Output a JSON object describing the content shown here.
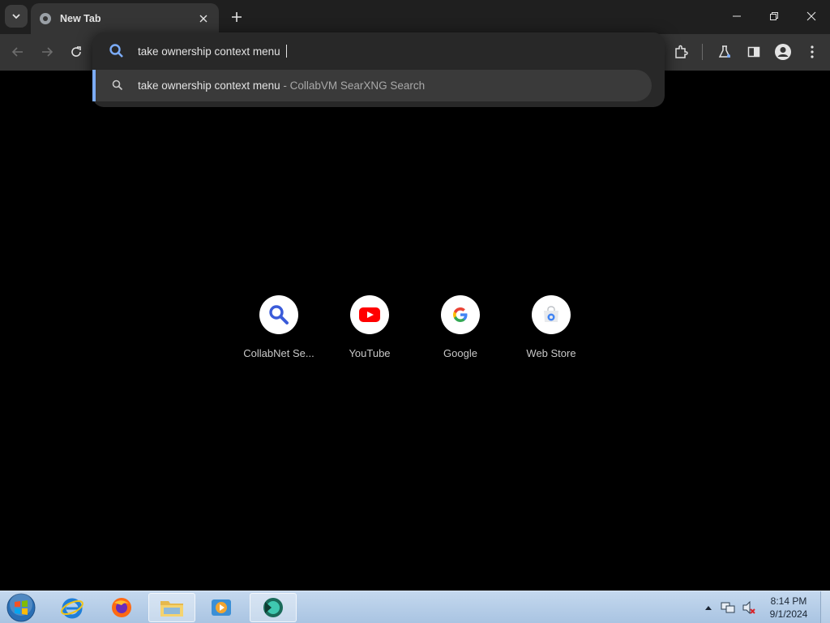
{
  "browser": {
    "tab": {
      "title": "New Tab"
    },
    "omnibox": {
      "value": "take ownership context menu",
      "suggestion": {
        "query": "take ownership context menu",
        "separator": " - ",
        "engine": "CollabVM SearXNG Search"
      }
    },
    "toolbar_icons": [
      "back-icon",
      "forward-icon",
      "reload-icon",
      "extensions-icon",
      "labs-icon",
      "side-panel-icon",
      "profile-icon",
      "menu-icon"
    ],
    "accent_color": "#7cacf8"
  },
  "shortcuts": [
    {
      "label": "CollabNet Se...",
      "icon": "collabnet-search-icon"
    },
    {
      "label": "YouTube",
      "icon": "youtube-icon"
    },
    {
      "label": "Google",
      "icon": "google-icon"
    },
    {
      "label": "Web Store",
      "icon": "web-store-icon"
    }
  ],
  "taskbar": {
    "apps": [
      "internet-explorer-icon",
      "firefox-icon",
      "file-explorer-icon",
      "media-player-icon",
      "chromium-browser-icon"
    ],
    "clock": {
      "time": "8:14 PM",
      "date": "9/1/2024"
    }
  }
}
